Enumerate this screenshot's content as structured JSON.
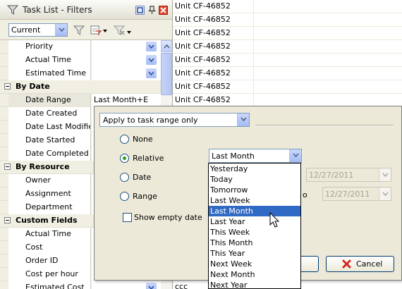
{
  "panel": {
    "title": "Task List - Filters",
    "view_select": "Current",
    "rows": [
      {
        "type": "prop",
        "label": "Priority",
        "value": "",
        "dropdown": true
      },
      {
        "type": "prop",
        "label": "Actual Time",
        "value": "",
        "dropdown": true
      },
      {
        "type": "prop",
        "label": "Estimated Time",
        "value": "",
        "dropdown": true
      },
      {
        "type": "cat",
        "label": "By Date"
      },
      {
        "type": "prop",
        "label": "Date Range",
        "value": "Last Month+E",
        "dropdown": false,
        "selected": true
      },
      {
        "type": "prop",
        "label": "Date Created",
        "value": ""
      },
      {
        "type": "prop",
        "label": "Date Last Modified",
        "value": ""
      },
      {
        "type": "prop",
        "label": "Date Started",
        "value": ""
      },
      {
        "type": "prop",
        "label": "Date Completed",
        "value": ""
      },
      {
        "type": "cat",
        "label": "By Resource"
      },
      {
        "type": "prop",
        "label": "Owner",
        "value": ""
      },
      {
        "type": "prop",
        "label": "Assignment",
        "value": ""
      },
      {
        "type": "prop",
        "label": "Department",
        "value": ""
      },
      {
        "type": "cat",
        "label": "Custom Fields"
      },
      {
        "type": "prop",
        "label": "Actual Time",
        "value": ""
      },
      {
        "type": "prop",
        "label": "Cost",
        "value": ""
      },
      {
        "type": "prop",
        "label": "Order ID",
        "value": ""
      },
      {
        "type": "prop",
        "label": "Cost per hour",
        "value": ""
      },
      {
        "type": "prop",
        "label": "Estimated Cost",
        "value": "",
        "dropdown": true
      }
    ]
  },
  "list": {
    "rows": [
      "Unit CF-46852",
      "Unit CF-46852",
      "Unit CF-46852",
      "Unit CF-46852",
      "Unit CF-46852",
      "Unit CF-46852",
      "Unit CF-46852",
      "Unit CF-46852"
    ],
    "last_row_fragment": "ccc"
  },
  "popup": {
    "scope_select": "Apply to task range only",
    "radios": [
      {
        "label": "None",
        "checked": false
      },
      {
        "label": "Relative",
        "checked": true
      },
      {
        "label": "Date",
        "checked": false
      },
      {
        "label": "Range",
        "checked": false
      }
    ],
    "relative_select": "Last Month",
    "date_field_1": "12/27/2011",
    "date_field_2": "12/27/2011",
    "to_fragment": "o",
    "show_empty_label": "Show empty date",
    "show_empty_checked": false,
    "cancel_label": "Cancel",
    "dropdown_items": [
      "Yesterday",
      "Today",
      "Tomorrow",
      "Last Week",
      "Last Month",
      "Last Year",
      "This Week",
      "This Month",
      "This Year",
      "Next Week",
      "Next Month",
      "Next Year"
    ],
    "dropdown_selected": "Last Month"
  },
  "colors": {
    "selection": "#316ac5",
    "radio_dot": "#21a121",
    "cancel_x": "#d8261d"
  }
}
